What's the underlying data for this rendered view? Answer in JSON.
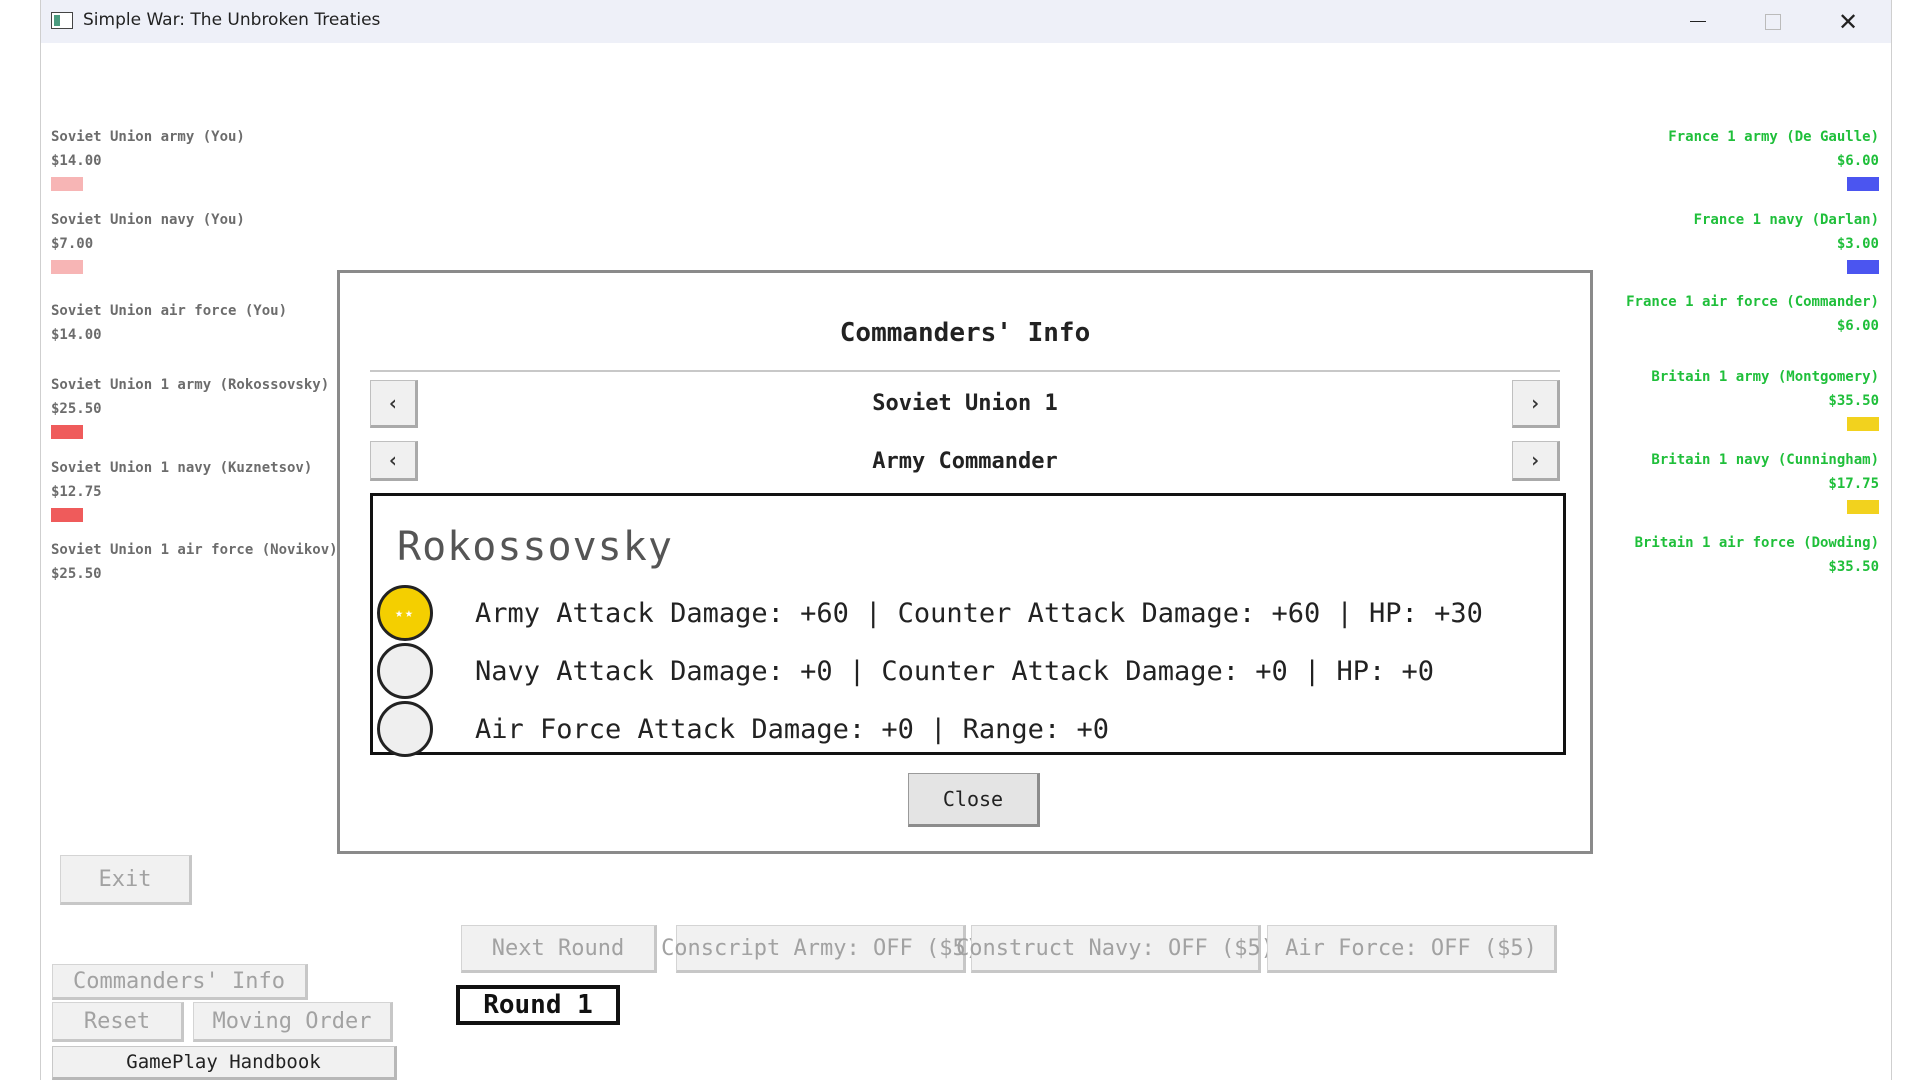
{
  "window": {
    "title": "Simple War: The Unbroken Treaties",
    "minimize": "—",
    "maximize": "☐",
    "close": "✕"
  },
  "colors": {
    "soviet_light": "#f7b5b5",
    "soviet": "#ef5b5b",
    "france": "#4b55f0",
    "britain": "#f2d21e",
    "enemy_text": "#1fbf3a",
    "gold": "#f4cf00"
  },
  "left_stats": [
    {
      "name": "Soviet Union army (You)",
      "money": "$14.00",
      "bar_color": "#f7b5b5"
    },
    {
      "name": "Soviet Union navy (You)",
      "money": "$7.00",
      "bar_color": "#f7b5b5"
    },
    {
      "name": "Soviet Union air force (You)",
      "money": "$14.00",
      "bar_color": ""
    },
    {
      "name": "Soviet Union 1 army (Rokossovsky)",
      "money": "$25.50",
      "bar_color": "#ef5b5b"
    },
    {
      "name": "Soviet Union 1 navy (Kuznetsov)",
      "money": "$12.75",
      "bar_color": "#ef5b5b"
    },
    {
      "name": "Soviet Union 1 air force (Novikov)",
      "money": "$25.50",
      "bar_color": ""
    }
  ],
  "right_stats": [
    {
      "name": "France 1 army (De Gaulle)",
      "money": "$6.00",
      "bar_color": "#4b55f0"
    },
    {
      "name": "France 1 navy (Darlan)",
      "money": "$3.00",
      "bar_color": "#4b55f0"
    },
    {
      "name": "France 1 air force (Commander)",
      "money": "$6.00",
      "bar_color": ""
    },
    {
      "name": "Britain 1 army (Montgomery)",
      "money": "$35.50",
      "bar_color": "#f2d21e"
    },
    {
      "name": "Britain 1 navy (Cunningham)",
      "money": "$17.75",
      "bar_color": "#f2d21e"
    },
    {
      "name": "Britain 1 air force (Dowding)",
      "money": "$35.50",
      "bar_color": ""
    }
  ],
  "buttons": {
    "exit": "Exit",
    "commanders_info": "Commanders' Info",
    "reset": "Reset",
    "moving_order": "Moving Order",
    "handbook": "GamePlay Handbook",
    "next_round": "Next Round",
    "conscript_army": "Conscript Army: OFF ($5)",
    "construct_navy": "Construct Navy: OFF ($5)",
    "air_force": "Air Force: OFF ($5)"
  },
  "round": "Round 1",
  "modal": {
    "title": "Commanders' Info",
    "country": "Soviet Union 1",
    "role": "Army Commander",
    "prev_glyph": "‹",
    "next_glyph": "›",
    "commander_name": "Rokossovsky",
    "rows": [
      {
        "stars": "★★",
        "level": 2,
        "text": "Army Attack Damage: +60 | Counter Attack Damage: +60 | HP: +30"
      },
      {
        "stars": "",
        "level": 0,
        "text": "Navy Attack Damage: +0 | Counter Attack Damage: +0 | HP: +0"
      },
      {
        "stars": "",
        "level": 0,
        "text": "Air Force Attack Damage: +0 | Range: +0"
      }
    ],
    "close": "Close"
  }
}
